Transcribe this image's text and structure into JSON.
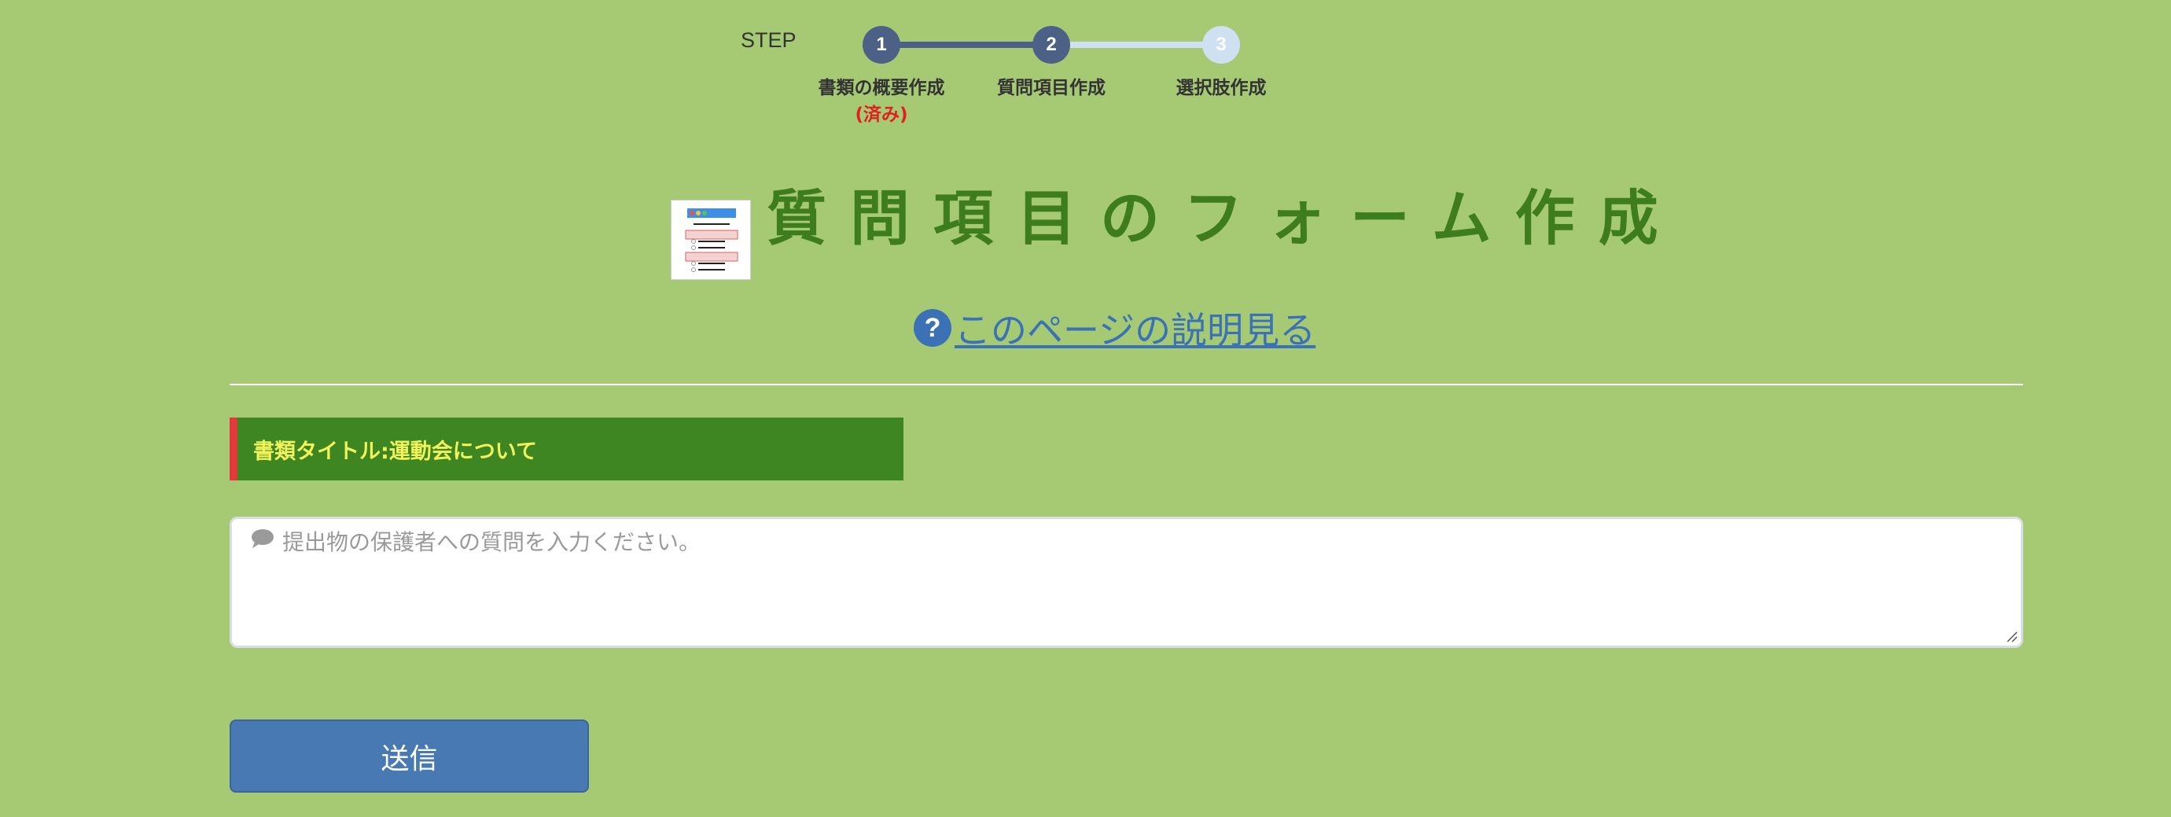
{
  "stepbar": {
    "step_word": "STEP",
    "steps": [
      {
        "number": "1",
        "label": "書類の概要作成",
        "status_note": "(済み)"
      },
      {
        "number": "2",
        "label": "質問項目作成"
      },
      {
        "number": "3",
        "label": "選択肢作成"
      }
    ]
  },
  "page": {
    "heading": "質問項目のフォーム作成",
    "help_link": "このページの説明見る"
  },
  "document": {
    "title_label": "書類タイトル:運動会について"
  },
  "question": {
    "placeholder": "提出物の保護者への質問を入力ください。"
  },
  "submit_label": "送信",
  "colors": {
    "background": "#a6ca74",
    "step_active": "#4d6187",
    "step_inactive": "#cfe0f0",
    "heading": "#3d7d1f",
    "link": "#3a72b5",
    "title_bar": "#3d8621",
    "title_bar_accent": "#e03a3a",
    "title_text": "#f2f25a",
    "button": "#4879b3"
  },
  "icons": {
    "heading": "form-icon",
    "help": "question-circle-icon",
    "question": "comment-icon"
  }
}
